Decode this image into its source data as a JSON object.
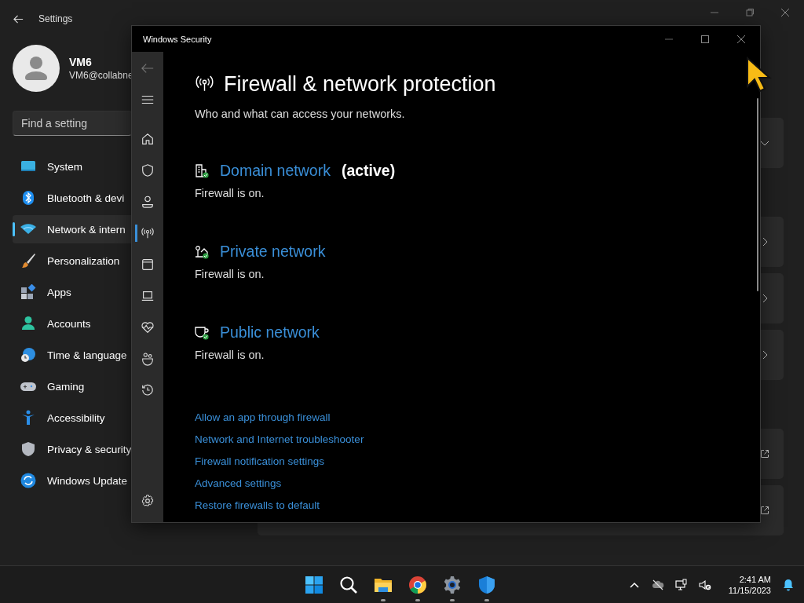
{
  "settings": {
    "title": "Settings",
    "profile": {
      "name": "VM6",
      "email": "VM6@collabne"
    },
    "search": {
      "placeholder": "Find a setting"
    },
    "nav": [
      {
        "label": "System",
        "kind": "system",
        "selected": false
      },
      {
        "label": "Bluetooth & devi",
        "kind": "bluetooth",
        "selected": false
      },
      {
        "label": "Network & intern",
        "kind": "network",
        "selected": true
      },
      {
        "label": "Personalization",
        "kind": "brush",
        "selected": false
      },
      {
        "label": "Apps",
        "kind": "apps",
        "selected": false
      },
      {
        "label": "Accounts",
        "kind": "accounts",
        "selected": false
      },
      {
        "label": "Time & language",
        "kind": "time",
        "selected": false
      },
      {
        "label": "Gaming",
        "kind": "gaming",
        "selected": false
      },
      {
        "label": "Accessibility",
        "kind": "accessibility",
        "selected": false
      },
      {
        "label": "Privacy & security",
        "kind": "privacy",
        "selected": false
      },
      {
        "label": "Windows Update",
        "kind": "update",
        "selected": false
      }
    ],
    "card_groups": [
      [
        {
          "kind": "expand"
        }
      ],
      [
        {
          "kind": "chevron"
        },
        {
          "kind": "chevron"
        },
        {
          "kind": "chevron"
        }
      ],
      [
        {
          "kind": "external"
        },
        {
          "kind": "external"
        }
      ]
    ]
  },
  "security": {
    "title": "Windows Security",
    "rail": [
      {
        "kind": "home",
        "selected": false
      },
      {
        "kind": "shield",
        "selected": false
      },
      {
        "kind": "person",
        "selected": false
      },
      {
        "kind": "network",
        "selected": true
      },
      {
        "kind": "window",
        "selected": false
      },
      {
        "kind": "laptop",
        "selected": false
      },
      {
        "kind": "heart",
        "selected": false
      },
      {
        "kind": "family",
        "selected": false
      },
      {
        "kind": "history",
        "selected": false
      }
    ],
    "heading": "Firewall & network protection",
    "subtitle": "Who and what can access your networks.",
    "networks": [
      {
        "kind": "domain",
        "name": "Domain network",
        "active_label": "(active)",
        "status": "Firewall is on."
      },
      {
        "kind": "private",
        "name": "Private network",
        "status": "Firewall is on."
      },
      {
        "kind": "public",
        "name": "Public network",
        "status": "Firewall is on."
      }
    ],
    "links": [
      "Allow an app through firewall",
      "Network and Internet troubleshooter",
      "Firewall notification settings",
      "Advanced settings",
      "Restore firewalls to default"
    ]
  },
  "taskbar": {
    "apps": [
      {
        "kind": "start",
        "running": false
      },
      {
        "kind": "search",
        "running": false
      },
      {
        "kind": "folder",
        "running": true
      },
      {
        "kind": "chrome",
        "running": true
      },
      {
        "kind": "gear",
        "running": true
      },
      {
        "kind": "shield",
        "running": true
      }
    ],
    "time": "2:41 AM",
    "date": "11/15/2023"
  }
}
